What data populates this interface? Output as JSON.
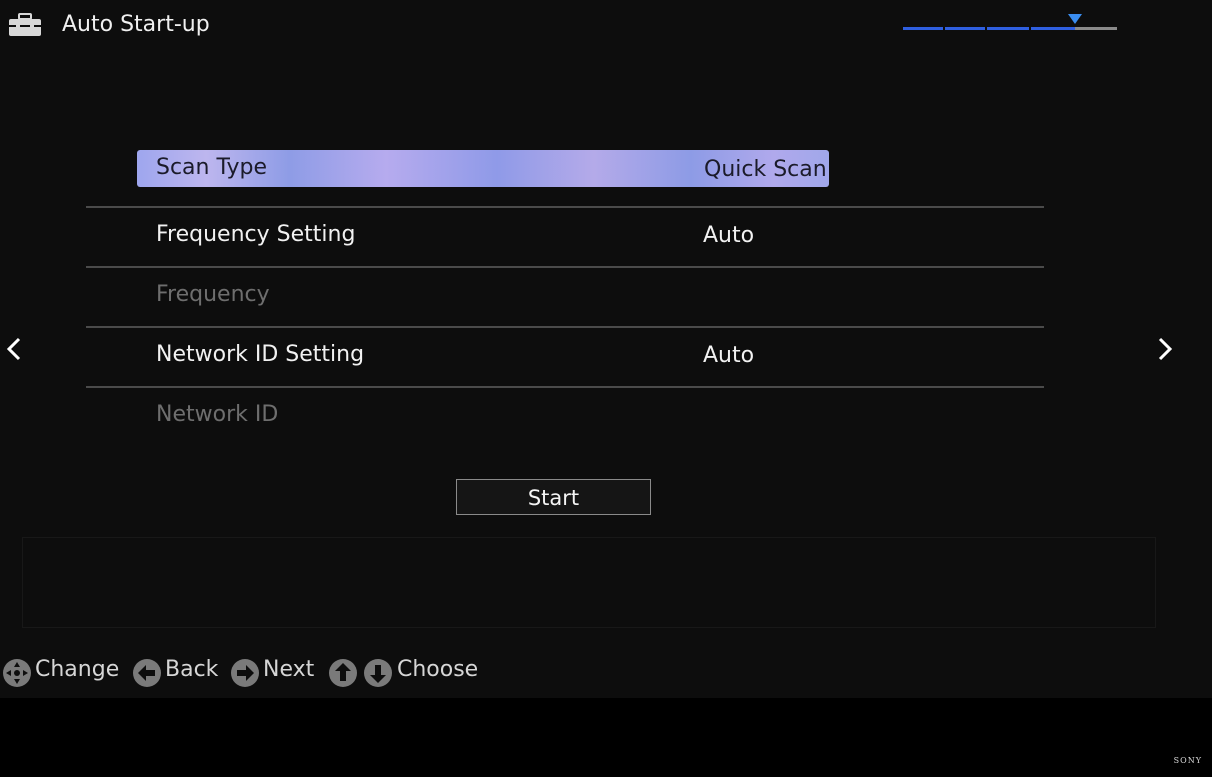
{
  "header": {
    "title": "Auto Start-up",
    "icon": "toolbox-icon",
    "progress": {
      "steps_completed": 4,
      "steps_total": 5,
      "active_color": "#2f5fe0",
      "inactive_color": "#8a8a8a",
      "marker_color": "#3a8df0"
    }
  },
  "menu": {
    "items": [
      {
        "label": "Scan Type",
        "value": "Quick Scan",
        "state": "selected"
      },
      {
        "label": "Frequency Setting",
        "value": "Auto",
        "state": "enabled"
      },
      {
        "label": "Frequency",
        "value": "",
        "state": "disabled"
      },
      {
        "label": "Network ID Setting",
        "value": "Auto",
        "state": "enabled"
      },
      {
        "label": "Network ID",
        "value": "",
        "state": "disabled"
      }
    ]
  },
  "start_button": {
    "label": "Start"
  },
  "navigation": {
    "left_icon": "chevron-left-icon",
    "right_icon": "chevron-right-icon"
  },
  "hints": [
    {
      "icon": "dpad-icon",
      "label": "Change"
    },
    {
      "icon": "back-arrow-icon",
      "label": "Back"
    },
    {
      "icon": "next-arrow-icon",
      "label": "Next"
    },
    {
      "icon": "up-arrow-icon",
      "label": ""
    },
    {
      "icon": "down-arrow-icon",
      "label": "Choose"
    }
  ],
  "brand": "SONY",
  "colors": {
    "background": "#0d0d0d",
    "highlight": "#a9a8ec",
    "divider": "#4a4a4a",
    "text": "#f2f2f2",
    "disabled_text": "#6e6e6e"
  }
}
